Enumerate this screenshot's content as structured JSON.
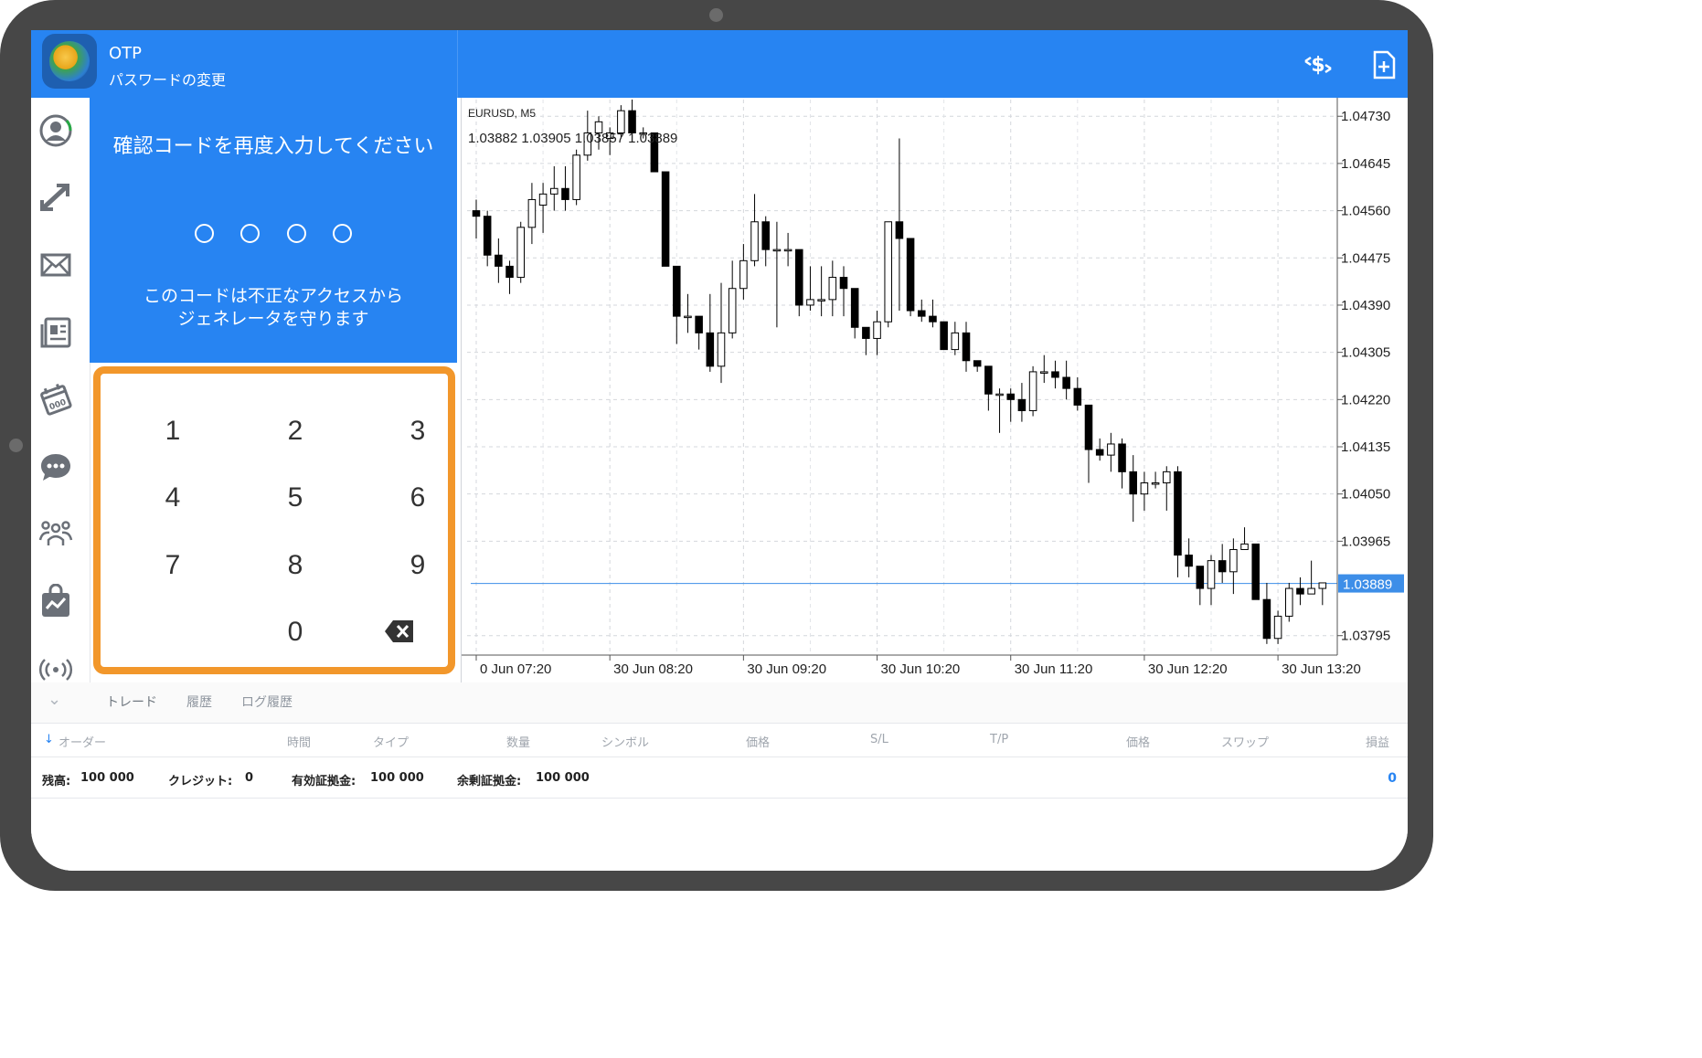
{
  "header": {
    "title": "OTP",
    "subtitle": "パスワードの変更"
  },
  "otp": {
    "prompt": "確認コードを再度入力してください",
    "description_line1": "このコードは不正なアクセスから",
    "description_line2": "ジェネレータを守ります",
    "digits_entered": 0,
    "digits_total": 4
  },
  "keypad": {
    "keys": [
      "1",
      "2",
      "3",
      "4",
      "5",
      "6",
      "7",
      "8",
      "9",
      "0"
    ],
    "highlight_color": "#f2972b"
  },
  "sidebar": {
    "items": [
      "account-icon",
      "trade-icon",
      "mail-icon",
      "news-icon",
      "calendar-icon",
      "chat-icon",
      "community-icon",
      "market-icon",
      "signal-icon"
    ]
  },
  "chart": {
    "symbol_label": "EURUSD, M5",
    "ohlc_label": "1.03882 1.03905 1.03857 1.03889",
    "current_price_label": "1.03889"
  },
  "chart_data": {
    "type": "candlestick",
    "symbol": "EURUSD",
    "timeframe": "M5",
    "y_ticks": [
      "1.04730",
      "1.04645",
      "1.04560",
      "1.04475",
      "1.04390",
      "1.04305",
      "1.04220",
      "1.04135",
      "1.04050",
      "1.03965",
      "1.03795"
    ],
    "x_ticks": [
      "0 Jun 07:20",
      "30 Jun 08:20",
      "30 Jun 09:20",
      "30 Jun 10:20",
      "30 Jun 11:20",
      "30 Jun 12:20",
      "30 Jun 13:20"
    ],
    "ylim": [
      1.0376,
      1.0476
    ],
    "current_price": 1.03889,
    "candles": [
      [
        1.0456,
        1.0458,
        1.0451,
        1.0455
      ],
      [
        1.0455,
        1.0456,
        1.0446,
        1.0448
      ],
      [
        1.0448,
        1.0451,
        1.0443,
        1.0446
      ],
      [
        1.0446,
        1.0447,
        1.0441,
        1.0444
      ],
      [
        1.0444,
        1.0454,
        1.0443,
        1.0453
      ],
      [
        1.0453,
        1.0461,
        1.045,
        1.0458
      ],
      [
        1.0457,
        1.0461,
        1.0452,
        1.0459
      ],
      [
        1.0459,
        1.0464,
        1.0456,
        1.046
      ],
      [
        1.046,
        1.0464,
        1.0456,
        1.0458
      ],
      [
        1.0458,
        1.0467,
        1.0457,
        1.0466
      ],
      [
        1.0466,
        1.0474,
        1.0465,
        1.047
      ],
      [
        1.047,
        1.0473,
        1.0467,
        1.0472
      ],
      [
        1.0469,
        1.0471,
        1.0466,
        1.047
      ],
      [
        1.047,
        1.0475,
        1.0469,
        1.0474
      ],
      [
        1.0474,
        1.0476,
        1.0469,
        1.047
      ],
      [
        1.047,
        1.0471,
        1.0469,
        1.047
      ],
      [
        1.047,
        1.047,
        1.0463,
        1.0463
      ],
      [
        1.0463,
        1.0463,
        1.0446,
        1.0446
      ],
      [
        1.0446,
        1.0446,
        1.0432,
        1.0437
      ],
      [
        1.0437,
        1.0441,
        1.0434,
        1.0437
      ],
      [
        1.0437,
        1.0437,
        1.0431,
        1.0434
      ],
      [
        1.0434,
        1.0441,
        1.0427,
        1.0428
      ],
      [
        1.0428,
        1.0443,
        1.0425,
        1.0434
      ],
      [
        1.0434,
        1.0447,
        1.0433,
        1.0442
      ],
      [
        1.0442,
        1.045,
        1.044,
        1.0447
      ],
      [
        1.0447,
        1.0459,
        1.0446,
        1.0454
      ],
      [
        1.0454,
        1.0455,
        1.0446,
        1.0449
      ],
      [
        1.0449,
        1.0454,
        1.0435,
        1.0449
      ],
      [
        1.0449,
        1.0452,
        1.0446,
        1.0449
      ],
      [
        1.0449,
        1.0449,
        1.0437,
        1.0439
      ],
      [
        1.0439,
        1.0446,
        1.0438,
        1.044
      ],
      [
        1.044,
        1.0446,
        1.0437,
        1.044
      ],
      [
        1.044,
        1.0447,
        1.0437,
        1.0444
      ],
      [
        1.0444,
        1.0446,
        1.0437,
        1.0442
      ],
      [
        1.0442,
        1.0442,
        1.0433,
        1.0435
      ],
      [
        1.0435,
        1.0435,
        1.043,
        1.0433
      ],
      [
        1.0433,
        1.0438,
        1.043,
        1.0436
      ],
      [
        1.0436,
        1.0454,
        1.0435,
        1.0454
      ],
      [
        1.0454,
        1.0469,
        1.0438,
        1.0451
      ],
      [
        1.0451,
        1.0451,
        1.0437,
        1.0438
      ],
      [
        1.0438,
        1.044,
        1.0436,
        1.0437
      ],
      [
        1.0437,
        1.044,
        1.0435,
        1.0436
      ],
      [
        1.0436,
        1.0436,
        1.0431,
        1.0431
      ],
      [
        1.0431,
        1.0436,
        1.043,
        1.0434
      ],
      [
        1.0434,
        1.0436,
        1.0427,
        1.0429
      ],
      [
        1.0429,
        1.0429,
        1.0427,
        1.0428
      ],
      [
        1.0428,
        1.0428,
        1.042,
        1.0423
      ],
      [
        1.0423,
        1.0424,
        1.0416,
        1.0423
      ],
      [
        1.0423,
        1.0424,
        1.0418,
        1.0422
      ],
      [
        1.0422,
        1.0425,
        1.0418,
        1.042
      ],
      [
        1.042,
        1.0428,
        1.0419,
        1.0427
      ],
      [
        1.0427,
        1.043,
        1.0425,
        1.0427
      ],
      [
        1.0427,
        1.0429,
        1.0424,
        1.0426
      ],
      [
        1.0426,
        1.0429,
        1.0422,
        1.0424
      ],
      [
        1.0424,
        1.0426,
        1.042,
        1.0421
      ],
      [
        1.0421,
        1.0421,
        1.0407,
        1.0413
      ],
      [
        1.0413,
        1.0415,
        1.0411,
        1.0412
      ],
      [
        1.0412,
        1.0416,
        1.0409,
        1.0414
      ],
      [
        1.0414,
        1.0415,
        1.0406,
        1.0409
      ],
      [
        1.0409,
        1.0412,
        1.04,
        1.0405
      ],
      [
        1.0405,
        1.0409,
        1.0402,
        1.0407
      ],
      [
        1.0407,
        1.0409,
        1.0406,
        1.0407
      ],
      [
        1.0407,
        1.041,
        1.0402,
        1.0409
      ],
      [
        1.0409,
        1.041,
        1.039,
        1.0394
      ],
      [
        1.0394,
        1.0397,
        1.039,
        1.0392
      ],
      [
        1.0392,
        1.0392,
        1.0385,
        1.0388
      ],
      [
        1.0388,
        1.0394,
        1.0385,
        1.0393
      ],
      [
        1.0393,
        1.0396,
        1.0389,
        1.0391
      ],
      [
        1.0391,
        1.0397,
        1.0387,
        1.0395
      ],
      [
        1.0395,
        1.0399,
        1.0395,
        1.0396
      ],
      [
        1.0396,
        1.0396,
        1.0386,
        1.0386
      ],
      [
        1.0386,
        1.0389,
        1.0378,
        1.0379
      ],
      [
        1.0379,
        1.0384,
        1.0378,
        1.0383
      ],
      [
        1.0383,
        1.0389,
        1.0382,
        1.0388
      ],
      [
        1.0388,
        1.039,
        1.0385,
        1.0387
      ],
      [
        1.0387,
        1.0393,
        1.0387,
        1.0388
      ],
      [
        1.0388,
        1.0389,
        1.0385,
        1.0389
      ]
    ]
  },
  "bottom": {
    "tabs": [
      "トレード",
      "履歴",
      "ログ履歴"
    ],
    "columns": {
      "order": "オーダー",
      "time": "時間",
      "type": "タイプ",
      "volume": "数量",
      "symbol": "シンボル",
      "price": "価格",
      "sl": "S/L",
      "tp": "T/P",
      "price2": "価格",
      "swap": "スワップ",
      "profit": "損益"
    },
    "balance": {
      "balance_label": "残高:",
      "balance_value": "100 000",
      "credit_label": "クレジット:",
      "credit_value": "0",
      "equity_label": "有効証拠金:",
      "equity_value": "100 000",
      "free_margin_label": "余剰証拠金:",
      "free_margin_value": "100 000",
      "total_profit": "0"
    }
  },
  "colors": {
    "accent": "#2784f2",
    "frame": "#474747",
    "keypad_border": "#f2972b",
    "price_line": "#3d8ee8"
  }
}
